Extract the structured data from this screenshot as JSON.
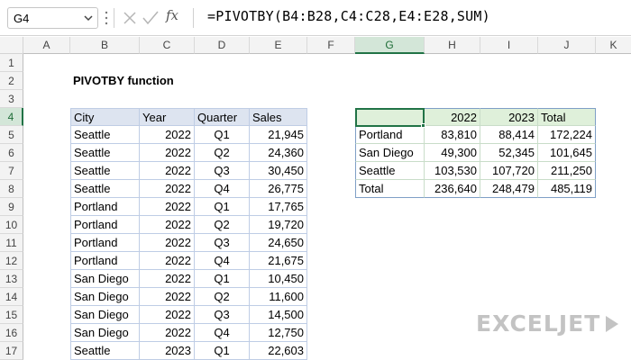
{
  "formula_bar": {
    "name_box": "G4",
    "fx_label": "fx",
    "formula": "=PIVOTBY(B4:B28,C4:C28,E4:E28,SUM)"
  },
  "columns": [
    "A",
    "B",
    "C",
    "D",
    "E",
    "F",
    "G",
    "H",
    "I",
    "J",
    "K"
  ],
  "rows": [
    "1",
    "2",
    "3",
    "4",
    "5",
    "6",
    "7",
    "8",
    "9",
    "10",
    "11",
    "12",
    "13",
    "14",
    "15",
    "16",
    "17"
  ],
  "title": "PIVOTBY function",
  "source": {
    "headers": [
      "City",
      "Year",
      "Quarter",
      "Sales"
    ],
    "rows": [
      [
        "Seattle",
        "2022",
        "Q1",
        "21,945"
      ],
      [
        "Seattle",
        "2022",
        "Q2",
        "24,360"
      ],
      [
        "Seattle",
        "2022",
        "Q3",
        "30,450"
      ],
      [
        "Seattle",
        "2022",
        "Q4",
        "26,775"
      ],
      [
        "Portland",
        "2022",
        "Q1",
        "17,765"
      ],
      [
        "Portland",
        "2022",
        "Q2",
        "19,720"
      ],
      [
        "Portland",
        "2022",
        "Q3",
        "24,650"
      ],
      [
        "Portland",
        "2022",
        "Q4",
        "21,675"
      ],
      [
        "San Diego",
        "2022",
        "Q1",
        "10,450"
      ],
      [
        "San Diego",
        "2022",
        "Q2",
        "11,600"
      ],
      [
        "San Diego",
        "2022",
        "Q3",
        "14,500"
      ],
      [
        "San Diego",
        "2022",
        "Q4",
        "12,750"
      ],
      [
        "Seattle",
        "2023",
        "Q1",
        "22,603"
      ]
    ]
  },
  "pivot": {
    "headers": [
      "",
      "2022",
      "2023",
      "Total"
    ],
    "rows": [
      [
        "Portland",
        "83,810",
        "88,414",
        "172,224"
      ],
      [
        "San Diego",
        "49,300",
        "52,345",
        "101,645"
      ],
      [
        "Seattle",
        "103,530",
        "107,720",
        "211,250"
      ],
      [
        "Total",
        "236,640",
        "248,479",
        "485,119"
      ]
    ]
  },
  "brand": {
    "logo_text": "EXCELJET",
    "accent": "#217346",
    "logo_color": "#c3c3c3"
  }
}
